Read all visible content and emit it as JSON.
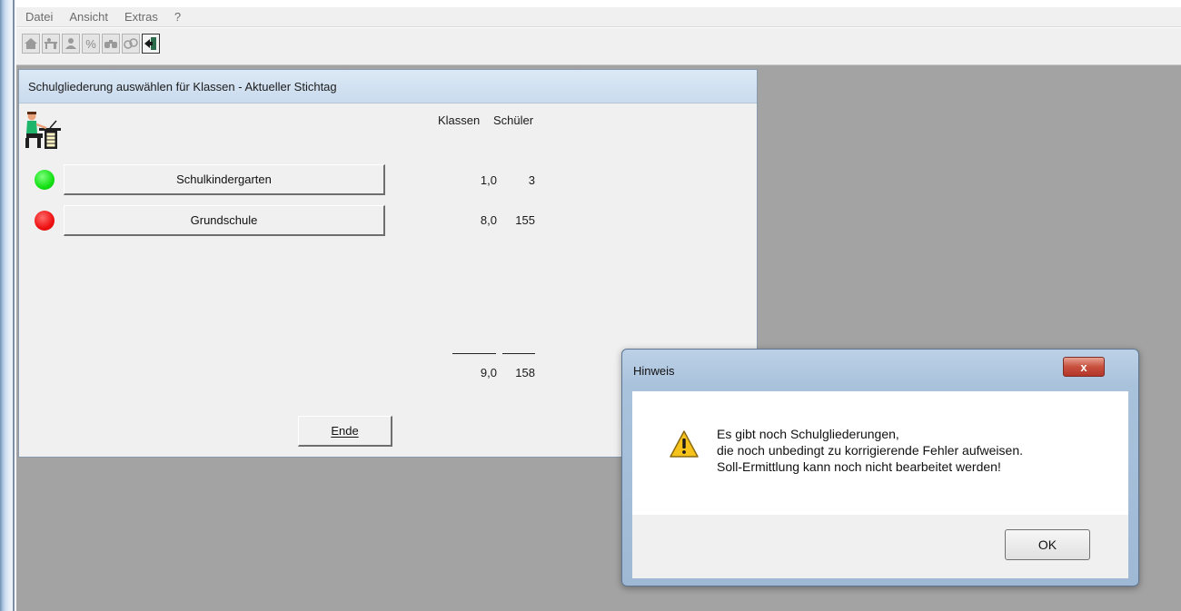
{
  "menu": {
    "items": [
      "Datei",
      "Ansicht",
      "Extras",
      "?"
    ]
  },
  "toolbar": {
    "icons": [
      "home-icon",
      "desk-icon",
      "teacher-icon",
      "percent-icon",
      "binoculars-icon",
      "coins-icon",
      "exit-icon"
    ],
    "percent_glyph": "%"
  },
  "child_window": {
    "title": "Schulgliederung auswählen für Klassen - Aktueller Stichtag",
    "column_klassen": "Klassen",
    "column_schueler": "Schüler",
    "rows": [
      {
        "status": "green",
        "status_color": "#19e019",
        "label": "Schulkindergarten",
        "klassen": "1,0",
        "schueler": "3"
      },
      {
        "status": "red",
        "status_color": "#ee1111",
        "label": "Grundschule",
        "klassen": "8,0",
        "schueler": "155"
      }
    ],
    "total_klassen": "9,0",
    "total_schueler": "158",
    "end_button": "Ende"
  },
  "dialog": {
    "title": "Hinweis",
    "close_glyph": "x",
    "message_lines": [
      "Es gibt noch Schulgliederungen,",
      "die noch unbedingt zu korrigierende Fehler aufweisen.",
      "Soll-Ermittlung kann noch nicht bearbeitet werden!"
    ],
    "ok_label": "OK"
  },
  "colors": {
    "workspace": "#a3a3a3",
    "title_gradient_top": "#dce8f5",
    "warning": "#f6c21c"
  }
}
